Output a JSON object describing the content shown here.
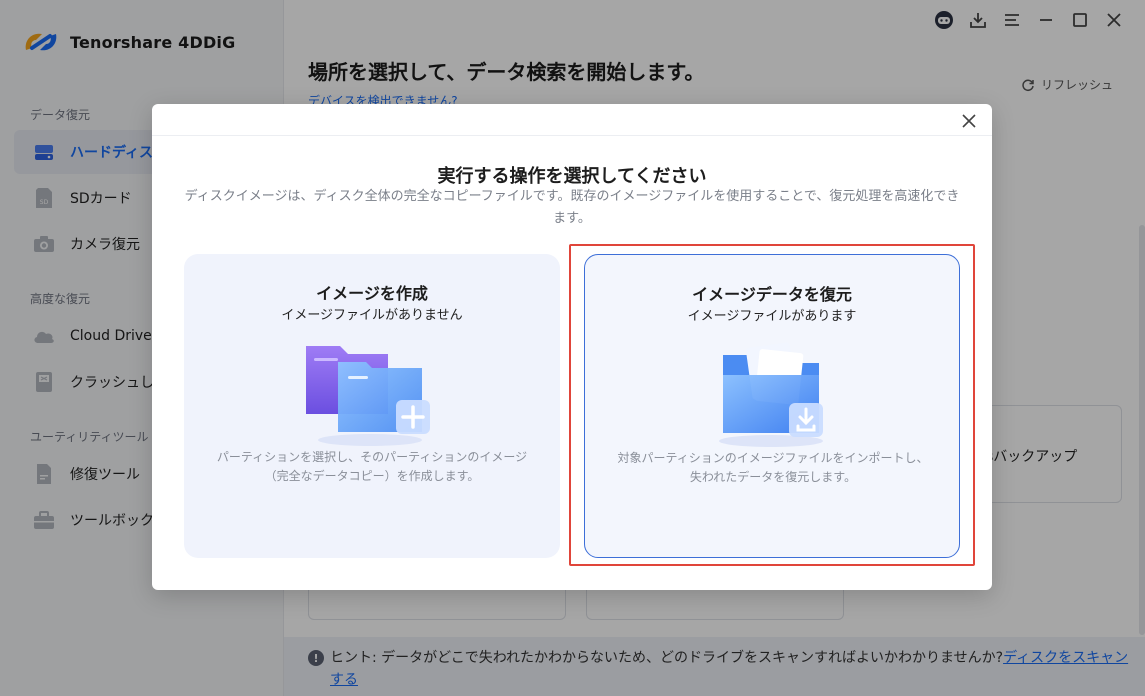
{
  "app": {
    "name": "Tenorshare 4DDiG"
  },
  "sidebar": {
    "sections": [
      {
        "title": "データ復元",
        "items": [
          {
            "label": "ハードディスク",
            "icon": "hard-drive-icon",
            "active": true
          },
          {
            "label": "SDカード",
            "icon": "sd-card-icon"
          },
          {
            "label": "カメラ復元",
            "icon": "camera-icon"
          }
        ]
      },
      {
        "title": "高度な復元",
        "items": [
          {
            "label": "Cloud Drive",
            "icon": "cloud-icon"
          },
          {
            "label": "クラッシュし",
            "icon": "crashed-pc-icon"
          }
        ]
      },
      {
        "title": "ユーティリティツール",
        "items": [
          {
            "label": "修復ツール",
            "icon": "repair-doc-icon"
          },
          {
            "label": "ツールボック",
            "icon": "toolbox-icon"
          }
        ]
      }
    ]
  },
  "main": {
    "title": "場所を選択して、データ検索を開始します。",
    "detect_link": "デバイスを検出できません?",
    "refresh_label": "リフレッシュ",
    "bg_card_label": "sバックアップ",
    "hint": {
      "prefix": "ヒント: データがどこで失われたかわからないため、どのドライブをスキャンすればよいかわかりませんか?",
      "link": "ディスクをスキャンする"
    }
  },
  "modal": {
    "title": "実行する操作を選択してください",
    "description": "ディスクイメージは、ディスク全体の完全なコピーファイルです。既存のイメージファイルを使用することで、復元処理を高速化できます。",
    "options": [
      {
        "title": "イメージを作成",
        "subtitle": "イメージファイルがありません",
        "description": "パーティションを選択し、そのパーティションのイメージ（完全なデータコピー）を作成します。",
        "icon": "create-image-folder-icon"
      },
      {
        "title": "イメージデータを復元",
        "subtitle": "イメージファイルがあります",
        "description": "対象パーティションのイメージファイルをインポートし、失われたデータを復元します。",
        "icon": "restore-image-folder-icon",
        "selected": true
      }
    ]
  },
  "colors": {
    "accent": "#1a6cf5",
    "highlight": "#e0453a",
    "selected_border": "#3d6fd8"
  }
}
